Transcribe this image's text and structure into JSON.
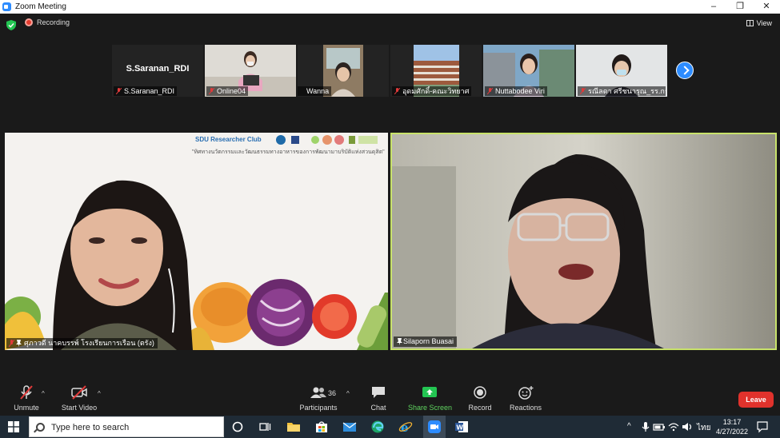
{
  "window": {
    "title": "Zoom Meeting",
    "controls": [
      "–",
      "❐",
      "✕"
    ]
  },
  "topbar": {
    "recording_label": "Recording",
    "view_label": "View"
  },
  "thumbnails": [
    {
      "name": "S.Saranan_RDI",
      "big_name": "S.Saranan_RDI",
      "muted": true
    },
    {
      "name": "Online04",
      "muted": true
    },
    {
      "name": "Wanna",
      "muted": false
    },
    {
      "name": "อุดมศักดิ์-คณะวิทยาศ",
      "muted": true
    },
    {
      "name": "Nuttabodee Viri",
      "muted": true
    },
    {
      "name": "รณีลดา ศรีชนารุณ_รร.กา",
      "muted": true
    }
  ],
  "main_videos": {
    "left": {
      "label": "ศุภาวดี นาคบรรพ์ โรงเรียนการเรือน (ตรัง)",
      "banner_title": "SDU Researcher Club",
      "banner_subtitle": "\"ทิศทางนวัตกรรมและวัฒนธรรมทางอาหารของการพัฒนามาบริบัติแห่งสวนดุสิต\""
    },
    "right": {
      "label": "Silaporn Buasai"
    }
  },
  "toolbar": {
    "unmute": "Unmute",
    "start_video": "Start Video",
    "participants": "Participants",
    "participants_count": "36",
    "chat": "Chat",
    "share_screen": "Share Screen",
    "record": "Record",
    "reactions": "Reactions",
    "leave": "Leave"
  },
  "taskbar": {
    "search_placeholder": "Type here to search",
    "time": "13:17",
    "date": "4/27/2022",
    "language": "ไทย"
  },
  "colors": {
    "active_speaker_border": "#c8e26a",
    "leave_red": "#e0322c",
    "share_green": "#5fd35f",
    "zoom_blue": "#2d8cff"
  }
}
